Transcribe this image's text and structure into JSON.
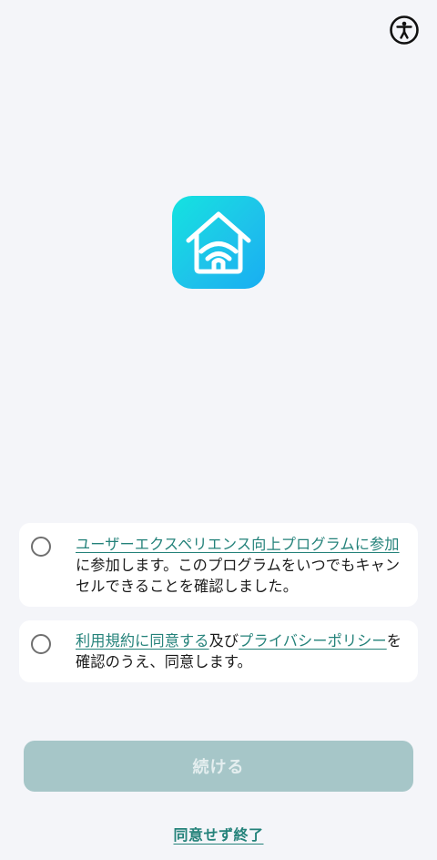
{
  "header": {
    "accessibility_icon": "accessibility-icon"
  },
  "logo": {
    "icon": "home-wifi-icon",
    "gradient_start": "#14e3e0",
    "gradient_end": "#18aef2"
  },
  "consents": [
    {
      "link_text": "ユーザーエクスペリエンス向上プログラムに参加",
      "text": "に参加します。このプログラムをいつでもキャンセルできることを確認しました。",
      "checked": false
    },
    {
      "link1_text": "利用規約に同意する",
      "mid_text": "及び",
      "link2_text": "プライバシーポリシー",
      "text": "を確認のうえ、同意します。",
      "checked": false
    }
  ],
  "actions": {
    "continue_label": "続ける",
    "continue_enabled": false,
    "disagree_label": "同意せず終了"
  },
  "colors": {
    "background": "#f4f5f9",
    "link": "#24827a",
    "button_disabled_bg": "#a6c6c8",
    "button_disabled_text": "#e4eeef"
  }
}
